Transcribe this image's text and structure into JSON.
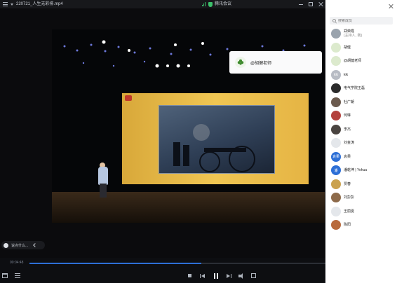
{
  "window": {
    "file_title": "220721_人生无彩排.mp4",
    "meeting_label": "腾讯会议"
  },
  "popup": {
    "name": "@胡健老师"
  },
  "panel": {
    "search_placeholder": "搜索成员",
    "members": [
      {
        "name": "郑荣霞",
        "sub": "(主持人, 我)",
        "avatar_color": "#9aa3ad",
        "avatar_text": ""
      },
      {
        "name": "胡健",
        "sub": "",
        "avatar_color": "#dceacd",
        "avatar_text": ""
      },
      {
        "name": "@胡健老师",
        "sub": "",
        "avatar_color": "#dceacd",
        "avatar_text": ""
      },
      {
        "name": "kik",
        "sub": "",
        "avatar_color": "#b8bcc4",
        "avatar_text": "kik"
      },
      {
        "name": "电气学院王磊",
        "sub": "",
        "avatar_color": "#2b2b2b",
        "avatar_text": ""
      },
      {
        "name": "杜广朝",
        "sub": "",
        "avatar_color": "#6b5a4e",
        "avatar_text": ""
      },
      {
        "name": "何琳",
        "sub": "",
        "avatar_color": "#b3413c",
        "avatar_text": ""
      },
      {
        "name": "李杰",
        "sub": "",
        "avatar_color": "#4a4440",
        "avatar_text": ""
      },
      {
        "name": "刘金涛",
        "sub": "",
        "avatar_color": "#e4e7eb",
        "avatar_text": ""
      },
      {
        "name": "袁果",
        "sub": "",
        "avatar_color": "#2d6fd6",
        "avatar_text": "袁果"
      },
      {
        "name": "潘乾坤 | Yohua",
        "sub": "",
        "avatar_color": "#2d6fd6",
        "avatar_text": "潘"
      },
      {
        "name": "贾春",
        "sub": "",
        "avatar_color": "#caa24f",
        "avatar_text": ""
      },
      {
        "name": "刘彭彭",
        "sub": "",
        "avatar_color": "#8d6a4a",
        "avatar_text": ""
      },
      {
        "name": "王丽雯",
        "sub": "",
        "avatar_color": "#e4e7eb",
        "avatar_text": ""
      },
      {
        "name": "陈阳",
        "sub": "",
        "avatar_color": "#b86a3c",
        "avatar_text": ""
      }
    ]
  },
  "chat": {
    "placeholder": "说点什么..."
  },
  "player": {
    "elapsed": "00:04:48",
    "progress": 0.58
  }
}
